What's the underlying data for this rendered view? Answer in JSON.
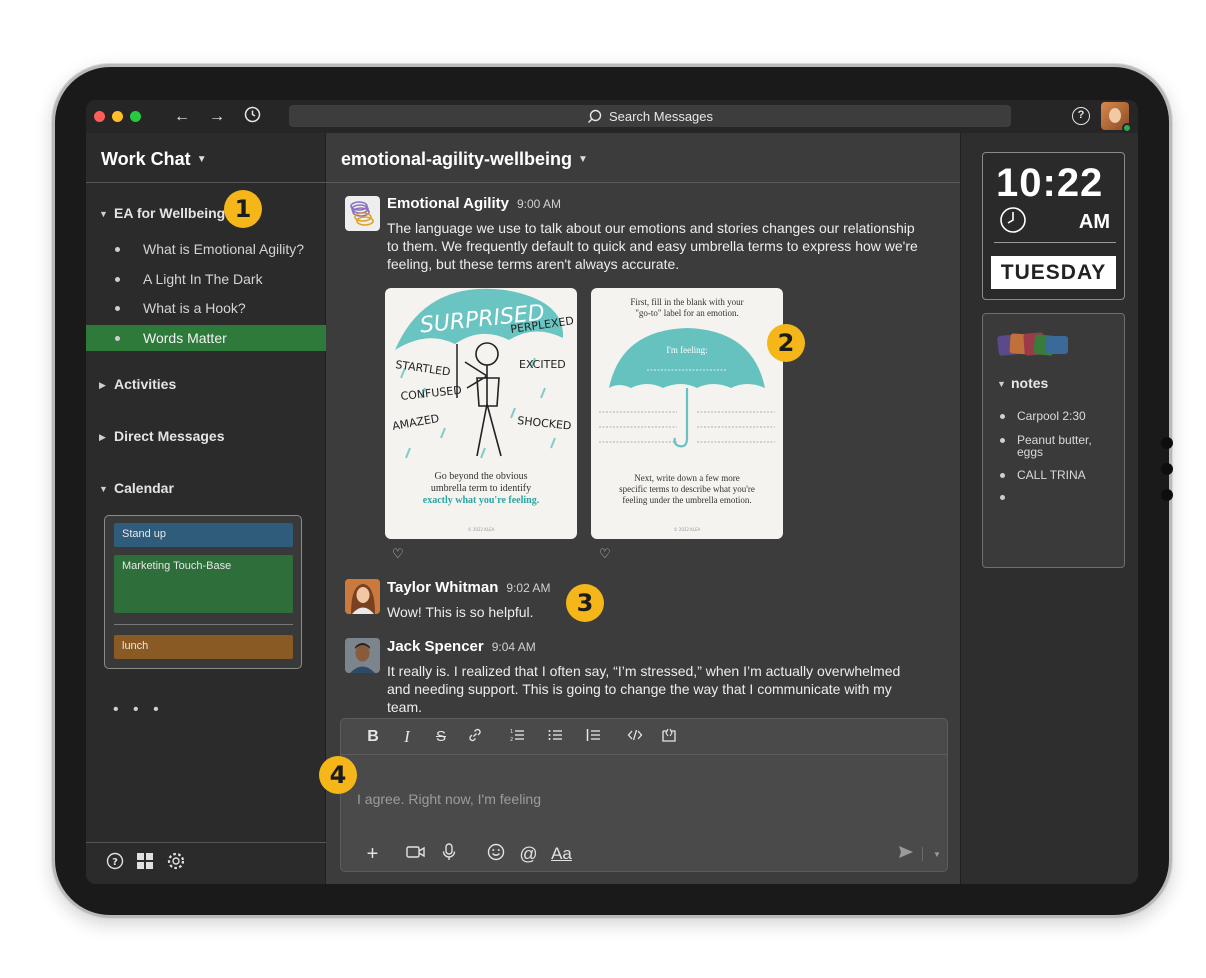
{
  "topbar": {
    "search_placeholder": "Search Messages",
    "back_icon": "←",
    "forward_icon": "→",
    "help_icon": "?"
  },
  "sidebar": {
    "workspace": "Work Chat",
    "sections": {
      "ea": "EA for Wellbeing",
      "activities": "Activities",
      "direct": "Direct Messages",
      "calendar": "Calendar"
    },
    "items": [
      {
        "label": "What is Emotional Agility?"
      },
      {
        "label": "A Light In The Dark"
      },
      {
        "label": "What is a Hook?"
      },
      {
        "label": "Words Matter"
      }
    ],
    "calendar_events": [
      {
        "label": "Stand up",
        "color": "#2f5c7a"
      },
      {
        "label": "Marketing Touch-Base",
        "color": "#2e6e3a"
      },
      {
        "label": "lunch",
        "color": "#8a5a25"
      }
    ],
    "more": "• • •"
  },
  "badges": {
    "b1": "1",
    "b2": "2",
    "b3": "3",
    "b4": "4"
  },
  "channel": {
    "title": "emotional-agility-wellbeing"
  },
  "messages": [
    {
      "author": "Emotional Agility",
      "time": "9:00 AM",
      "text": "The language we use to talk about our emotions and stories changes our relationship to them. We frequently default to quick and easy umbrella terms to express how we're feeling, but these terms aren't always accurate."
    },
    {
      "author": "Taylor Whitman",
      "time": "9:02 AM",
      "text": "Wow! This is so helpful."
    },
    {
      "author": "Jack Spencer",
      "time": "9:04 AM",
      "text": "It really is. I realized that I often say, “I’m stressed,” when I’m actually overwhelmed and needing support. This is going to change the way that I communicate with my team."
    }
  ],
  "card1": {
    "title": "SURPRISED",
    "words": [
      "PERPLEXED",
      "STARTLED",
      "EXCITED",
      "CONFUSED",
      "AMAZED",
      "SHOCKED"
    ],
    "caption_1": "Go beyond the obvious",
    "caption_2": "umbrella term to identify",
    "caption_3": "exactly what you're feeling.",
    "footer": "© 2022 KLEA"
  },
  "card2": {
    "top_1": "First, fill in the blank with your",
    "top_2": "\"go-to\" label for an emotion.",
    "feeling": "I'm feeling:",
    "caption_1": "Next, write down a few more",
    "caption_2": "specific terms to describe what you're",
    "caption_3": "feeling under the umbrella emotion.",
    "footer": "© 2022 KLEA"
  },
  "composer": {
    "value": "I agree. Right now, I'm feeling"
  },
  "clock": {
    "time": "10:22",
    "ampm": "AM",
    "day": "TUESDAY"
  },
  "notes": {
    "title": "notes",
    "items": [
      "Carpool 2:30",
      "Peanut butter, eggs",
      "CALL TRINA",
      ""
    ]
  },
  "colors": {
    "accent_green": "#2d7a3b",
    "badge": "#f4b618"
  }
}
